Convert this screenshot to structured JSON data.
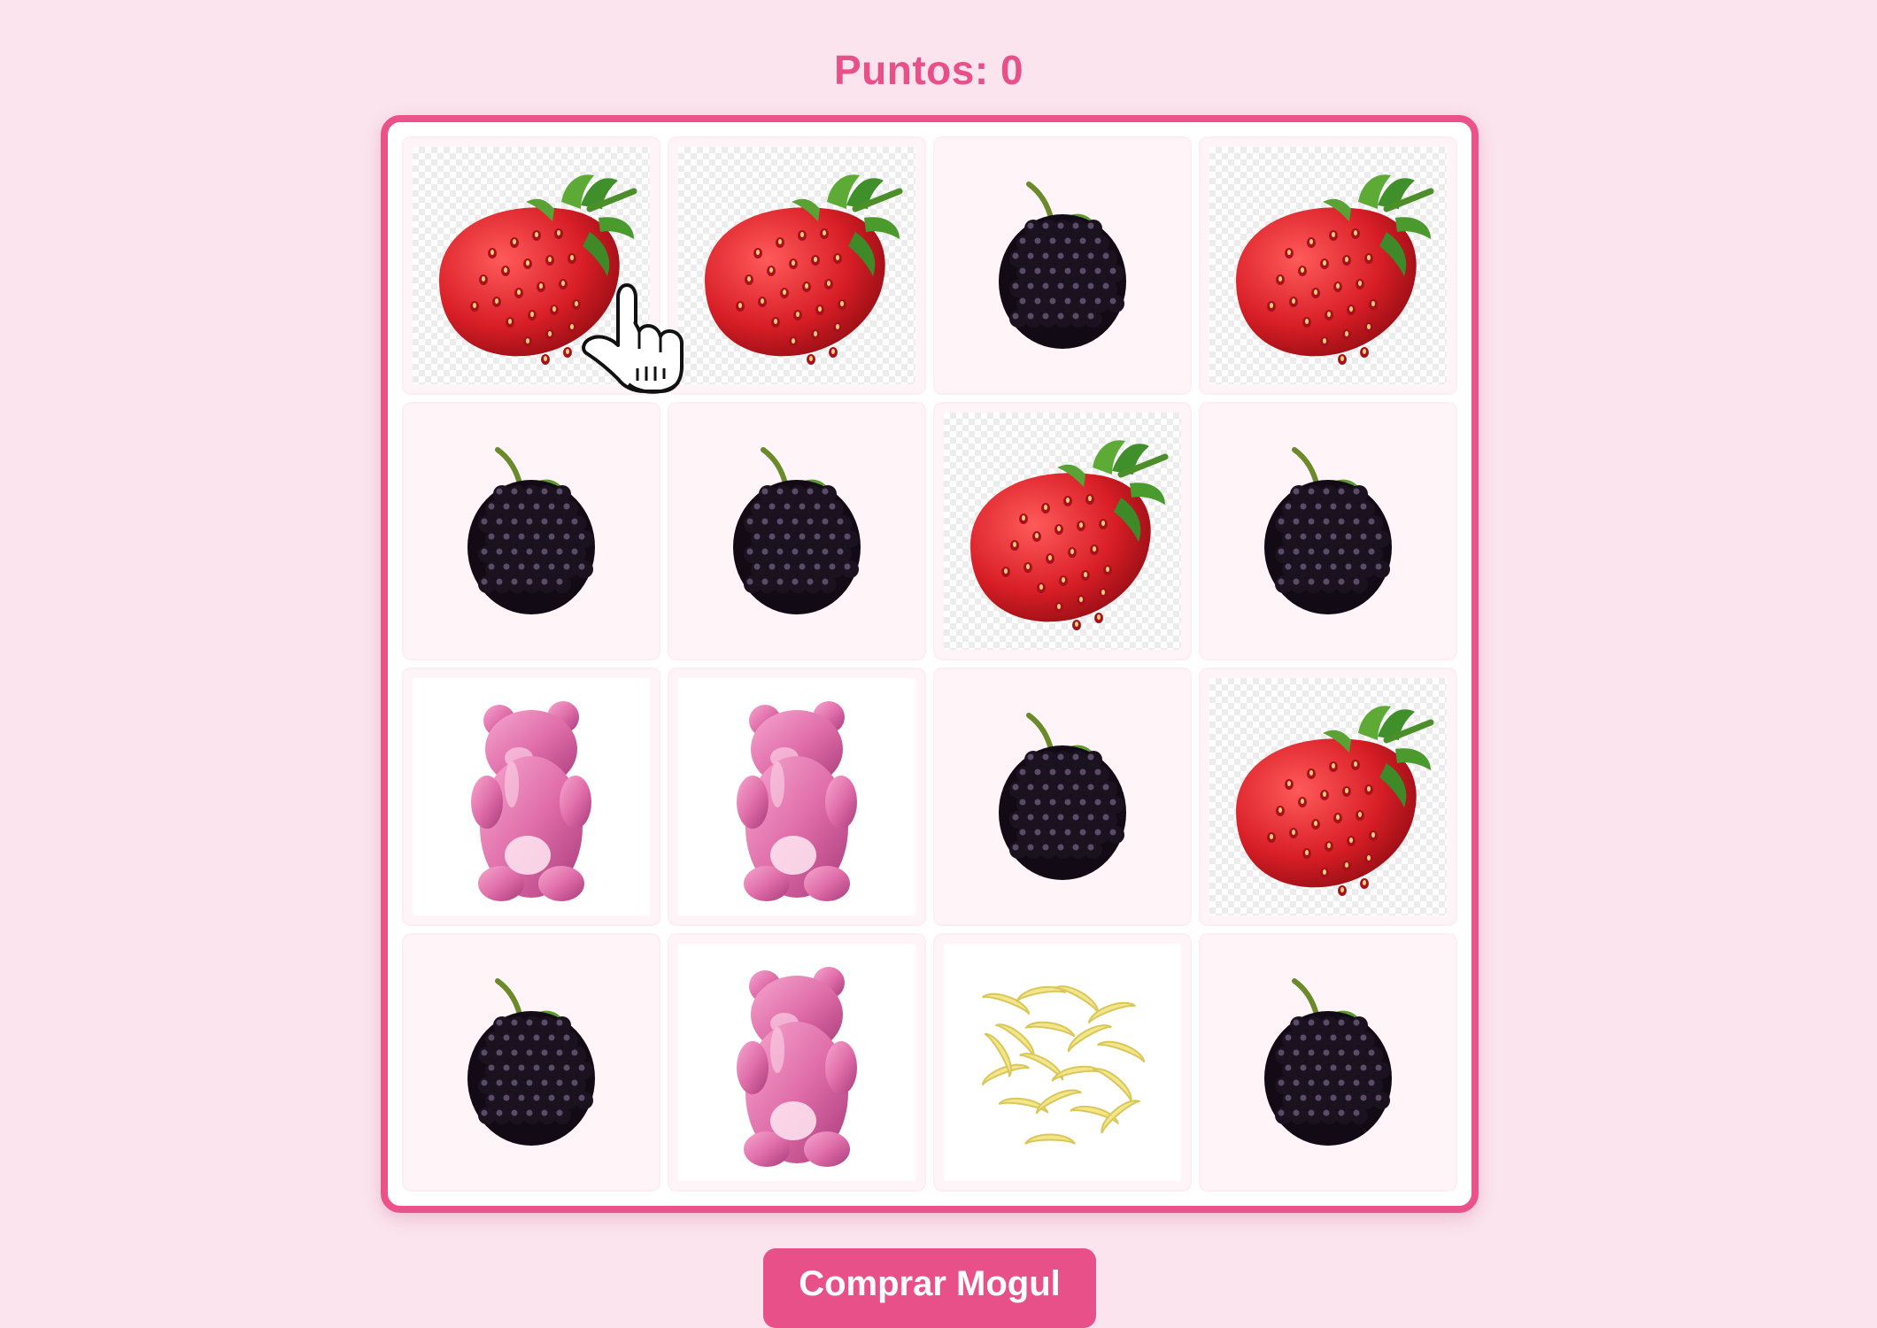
{
  "score": {
    "label": "Puntos: 0",
    "value": 0
  },
  "board": {
    "rows": 4,
    "cols": 4,
    "cards": [
      "strawberry",
      "strawberry",
      "blackberry",
      "strawberry",
      "blackberry",
      "blackberry",
      "strawberry",
      "blackberry",
      "gummy-bear",
      "gummy-bear",
      "blackberry",
      "strawberry",
      "blackberry",
      "gummy-bear",
      "banana-candy",
      "blackberry"
    ]
  },
  "buy_button": {
    "label": "Comprar Mogul"
  },
  "colors": {
    "background": "#fbe4ee",
    "accent": "#e8508a",
    "board_border": "#ea5289"
  }
}
